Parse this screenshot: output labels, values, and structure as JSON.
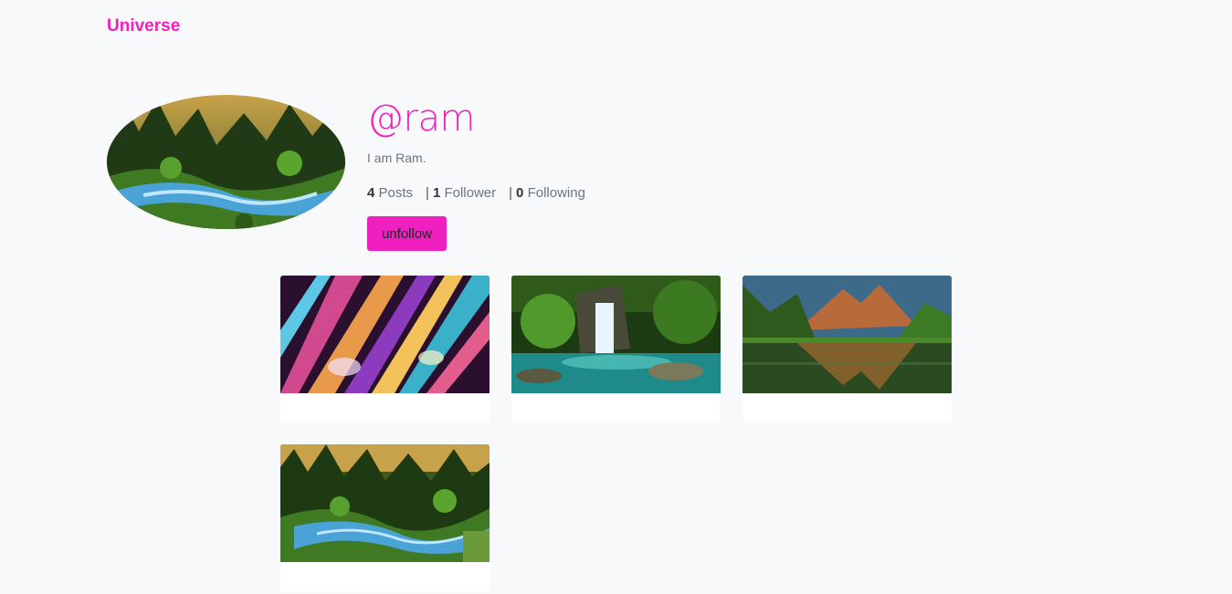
{
  "nav": {
    "brand": "Universe"
  },
  "profile": {
    "username": "@ram",
    "bio": "I am Ram.",
    "stats": [
      {
        "count": "4",
        "label": "Posts"
      },
      {
        "count": "1",
        "label": "Follower"
      },
      {
        "count": "0",
        "label": "Following"
      }
    ],
    "action_label": "unfollow",
    "accent_color": "#f01fbf"
  },
  "posts": [
    {
      "image": "abstract-light-rays"
    },
    {
      "image": "forest-waterfall"
    },
    {
      "image": "mountain-lake"
    },
    {
      "image": "forest-river"
    }
  ]
}
